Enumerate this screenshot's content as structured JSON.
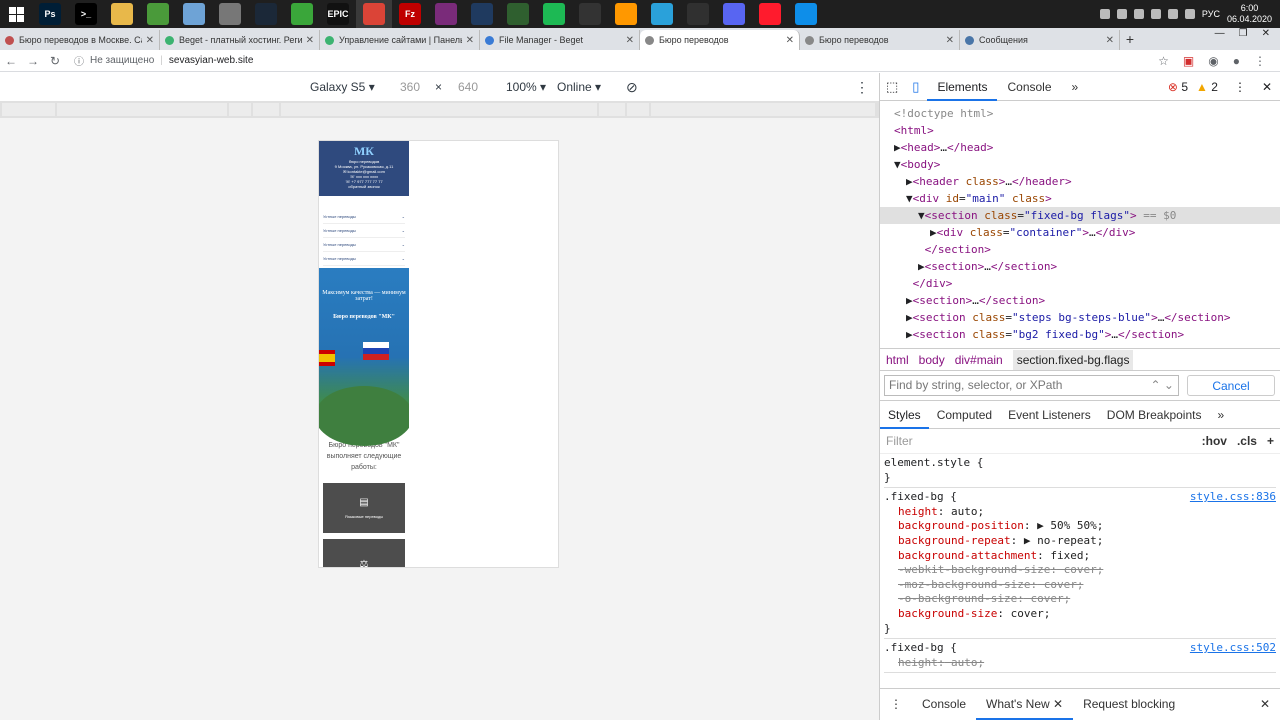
{
  "taskbar": {
    "apps": [
      {
        "icon": "photoshop-icon",
        "label": "Ps",
        "color": "#001e36"
      },
      {
        "icon": "terminal-icon",
        "label": ">_",
        "color": "#000000"
      },
      {
        "icon": "explorer-icon",
        "label": "",
        "color": "#e8b84a"
      },
      {
        "icon": "notepad-icon",
        "label": "",
        "color": "#4a9a3a"
      },
      {
        "icon": "paint-icon",
        "label": "",
        "color": "#6ea3d6"
      },
      {
        "icon": "calculator-icon",
        "label": "",
        "color": "#777777"
      },
      {
        "icon": "steam-icon",
        "label": "",
        "color": "#1b2838"
      },
      {
        "icon": "torrent-icon",
        "label": "",
        "color": "#3aa63a"
      },
      {
        "icon": "epic-games-icon",
        "label": "EPIC",
        "color": "#111111"
      },
      {
        "icon": "chrome-icon",
        "label": "",
        "color": "#db4437"
      },
      {
        "icon": "filezilla-icon",
        "label": "Fz",
        "color": "#bf0000"
      },
      {
        "icon": "winrar-icon",
        "label": "",
        "color": "#7a2b7a"
      },
      {
        "icon": "ide-icon",
        "label": "",
        "color": "#1f3a5f"
      },
      {
        "icon": "game-icon",
        "label": "",
        "color": "#2f5f2f"
      },
      {
        "icon": "spotify-icon",
        "label": "",
        "color": "#1db954"
      },
      {
        "icon": "app-icon",
        "label": "",
        "color": "#333333"
      },
      {
        "icon": "sublime-icon",
        "label": "",
        "color": "#ff9800"
      },
      {
        "icon": "telegram-icon",
        "label": "",
        "color": "#2aa1da"
      },
      {
        "icon": "obs-icon",
        "label": "",
        "color": "#303030"
      },
      {
        "icon": "discord-icon",
        "label": "",
        "color": "#5865f2"
      },
      {
        "icon": "opera-icon",
        "label": "",
        "color": "#ff1b2d"
      },
      {
        "icon": "teamviewer-icon",
        "label": "",
        "color": "#0e8ee9"
      }
    ],
    "lang": "РУС",
    "time": "6:00",
    "date": "06.04.2020"
  },
  "tabs": [
    {
      "title": "Бюро переводов в Москве. Са",
      "active": false,
      "fav": "#c05050"
    },
    {
      "title": "Beget - платный хостинг. Регист",
      "active": false,
      "fav": "#3cb371"
    },
    {
      "title": "Управление сайтами | Панель у",
      "active": false,
      "fav": "#3cb371"
    },
    {
      "title": "File Manager - Beget",
      "active": false,
      "fav": "#3a7bd5"
    },
    {
      "title": "Бюро переводов",
      "active": true,
      "fav": "#888888"
    },
    {
      "title": "Бюро переводов",
      "active": false,
      "fav": "#888888"
    },
    {
      "title": "Сообщения",
      "active": false,
      "fav": "#4a76a8"
    }
  ],
  "address": {
    "security": "Не защищено",
    "url": "sevasyian-web.site"
  },
  "device_toolbar": {
    "device": "Galaxy S5",
    "width": "360",
    "x": "×",
    "height": "640",
    "zoom": "100%",
    "network": "Online"
  },
  "site": {
    "logo": "МК",
    "logo_sub": "бюро переводов",
    "contacts": [
      "9 Москва, ул. Русаковская, д.11",
      "✉ kontakte@gmail.com",
      "☏ xxx xxx xxxx",
      "☏ +7 977 777 77 77",
      "обратный звонок"
    ],
    "menu": [
      "Устные переводы",
      "Устные переводы",
      "Устные переводы",
      "Устные переводы"
    ],
    "banner_line1": "Максимум качества — минимум затрат!",
    "banner_line2": "Бюро переводов \"МК\"",
    "intro": "Бюро переводов \"МК\" выполняет следующие работы:",
    "card1": "Языковые переводы"
  },
  "devtools": {
    "tabs": [
      "Elements",
      "Console",
      "»"
    ],
    "errors": "5",
    "warnings": "2",
    "dom": [
      {
        "indent": 0,
        "html": "<span class='cm'>&lt;!doctype html&gt;</span>"
      },
      {
        "indent": 0,
        "html": "<span class='tag'>&lt;html&gt;</span>"
      },
      {
        "indent": 0,
        "html": "▶<span class='tag'>&lt;head&gt;</span>…<span class='tag'>&lt;/head&gt;</span>"
      },
      {
        "indent": 0,
        "html": "▼<span class='tag'>&lt;body&gt;</span>"
      },
      {
        "indent": 1,
        "html": "▶<span class='tag'>&lt;header </span><span class='attr'>class</span><span class='tag'>&gt;</span>…<span class='tag'>&lt;/header&gt;</span>"
      },
      {
        "indent": 1,
        "html": "▼<span class='tag'>&lt;div </span><span class='attr'>id</span>=<span class='val'>\"main\"</span> <span class='attr'>class</span><span class='tag'>&gt;</span>"
      },
      {
        "indent": 2,
        "sel": true,
        "html": "▼<span class='tag'>&lt;section </span><span class='attr'>class</span>=<span class='val'>\"fixed-bg flags\"</span><span class='tag'>&gt;</span> <span class='cm'>== $0</span>"
      },
      {
        "indent": 3,
        "html": "▶<span class='tag'>&lt;div </span><span class='attr'>class</span>=<span class='val'>\"container\"</span><span class='tag'>&gt;</span>…<span class='tag'>&lt;/div&gt;</span>"
      },
      {
        "indent": 2,
        "html": " <span class='tag'>&lt;/section&gt;</span>"
      },
      {
        "indent": 2,
        "html": "▶<span class='tag'>&lt;section&gt;</span>…<span class='tag'>&lt;/section&gt;</span>"
      },
      {
        "indent": 1,
        "html": " <span class='tag'>&lt;/div&gt;</span>"
      },
      {
        "indent": 1,
        "html": "▶<span class='tag'>&lt;section&gt;</span>…<span class='tag'>&lt;/section&gt;</span>"
      },
      {
        "indent": 1,
        "html": "▶<span class='tag'>&lt;section </span><span class='attr'>class</span>=<span class='val'>\"steps bg-steps-blue\"</span><span class='tag'>&gt;</span>…<span class='tag'>&lt;/section&gt;</span>"
      },
      {
        "indent": 1,
        "html": "▶<span class='tag'>&lt;section </span><span class='attr'>class</span>=<span class='val'>\"bg2 fixed-bg\"</span><span class='tag'>&gt;</span>…<span class='tag'>&lt;/section&gt;</span>"
      }
    ],
    "crumbs": [
      "html",
      "body",
      "div#main",
      "section.fixed-bg.flags"
    ],
    "find_placeholder": "Find by string, selector, or XPath",
    "cancel": "Cancel",
    "subtabs": [
      "Styles",
      "Computed",
      "Event Listeners",
      "DOM Breakpoints",
      "»"
    ],
    "filter": "Filter",
    "hov": ":hov",
    "cls": ".cls",
    "rules": [
      {
        "selector": "element.style {",
        "source": "",
        "props": [],
        "close": "}"
      },
      {
        "selector": ".fixed-bg {",
        "source": "style.css:836",
        "close": "}",
        "props": [
          {
            "n": "height",
            "v": "auto;",
            "s": false
          },
          {
            "n": "background-position",
            "v": "▶ 50% 50%;",
            "s": false
          },
          {
            "n": "background-repeat",
            "v": "▶ no-repeat;",
            "s": false
          },
          {
            "n": "background-attachment",
            "v": "fixed;",
            "s": false
          },
          {
            "n": "-webkit-background-size",
            "v": "cover;",
            "s": true
          },
          {
            "n": "-moz-background-size",
            "v": "cover;",
            "s": true
          },
          {
            "n": "-o-background-size",
            "v": "cover;",
            "s": true
          },
          {
            "n": "background-size",
            "v": "cover;",
            "s": false
          }
        ]
      },
      {
        "selector": ".fixed-bg {",
        "source": "style.css:502",
        "close": "",
        "props": [
          {
            "n": "height",
            "v": "auto;",
            "s": true
          }
        ]
      }
    ],
    "drawer": [
      "Console",
      "What's New ✕",
      "Request blocking"
    ]
  }
}
